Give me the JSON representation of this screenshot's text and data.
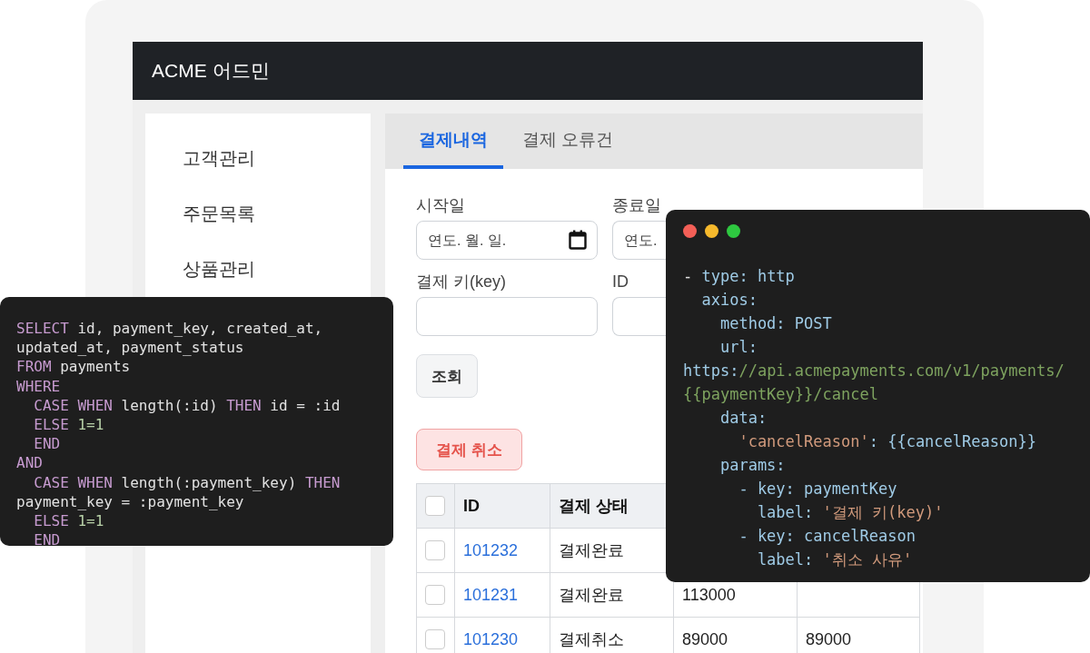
{
  "app": {
    "title": "ACME 어드민"
  },
  "sidebar": {
    "items": [
      {
        "label": "고객관리",
        "selected": false
      },
      {
        "label": "주문목록",
        "selected": false
      },
      {
        "label": "상품관리",
        "selected": false
      }
    ]
  },
  "tabs": [
    {
      "label": "결제내역",
      "selected": true
    },
    {
      "label": "결제 오류건",
      "selected": false
    }
  ],
  "filters": [
    {
      "label": "시작일",
      "placeholder": "연도. 월. 일.",
      "kind": "date"
    },
    {
      "label": "종료일",
      "placeholder": "연도.",
      "kind": "date"
    },
    {
      "label": "결제 키(key)",
      "kind": "text"
    },
    {
      "label": "ID",
      "kind": "text"
    }
  ],
  "search_button": "조회",
  "cancel_button": "결제 취소",
  "table": {
    "header_checked": false,
    "columns": [
      "ID",
      "결제 상태"
    ],
    "rows": [
      {
        "checked": false,
        "id": "101232",
        "status": "결제완료"
      },
      {
        "checked": false,
        "id": "101231",
        "status": "결제완료",
        "column_4": "113000"
      },
      {
        "checked": false,
        "id": "101230",
        "status": "결제취소",
        "column_4": "89000",
        "column_5": "89000"
      }
    ]
  },
  "sql_snippet": {
    "lines": [
      [
        {
          "text": "SELECT",
          "kind": "keyword"
        },
        {
          "text": " id, payment_key, created_at,",
          "kind": "plain"
        }
      ],
      [
        {
          "text": "updated_at, payment_status",
          "kind": "plain"
        }
      ],
      [
        {
          "text": "FROM",
          "kind": "keyword"
        },
        {
          "text": " payments",
          "kind": "plain"
        }
      ],
      [
        {
          "text": "WHERE",
          "kind": "keyword"
        }
      ],
      [
        {
          "text": "  CASE WHEN",
          "kind": "keyword"
        },
        {
          "text": " length(:id) ",
          "kind": "plain"
        },
        {
          "text": "THEN",
          "kind": "keyword"
        },
        {
          "text": " id = :id",
          "kind": "plain"
        }
      ],
      [
        {
          "text": "  ELSE",
          "kind": "keyword"
        },
        {
          "text": " 1=1",
          "kind": "number"
        }
      ],
      [
        {
          "text": "  END",
          "kind": "keyword"
        }
      ],
      [
        {
          "text": "AND",
          "kind": "keyword"
        }
      ],
      [
        {
          "text": "  CASE WHEN",
          "kind": "keyword"
        },
        {
          "text": " length(:payment_key) ",
          "kind": "plain"
        },
        {
          "text": "THEN",
          "kind": "keyword"
        }
      ],
      [
        {
          "text": "payment_key = :payment_key",
          "kind": "plain"
        }
      ],
      [
        {
          "text": "  ELSE",
          "kind": "keyword"
        },
        {
          "text": " 1=1",
          "kind": "number"
        }
      ],
      [
        {
          "text": "  END",
          "kind": "keyword"
        }
      ]
    ]
  },
  "yaml_snippet": {
    "lines": [
      [
        {
          "text": "- ",
          "kind": "plain"
        },
        {
          "text": "type: http",
          "kind": "key"
        }
      ],
      [
        {
          "text": "  axios:",
          "kind": "key"
        }
      ],
      [
        {
          "text": "    method: POST",
          "kind": "key"
        }
      ],
      [
        {
          "text": "    url:",
          "kind": "key"
        }
      ],
      [
        {
          "text": "https:",
          "kind": "key"
        },
        {
          "text": "//api.acmepayments.com/v1/payments/",
          "kind": "url"
        }
      ],
      [
        {
          "text": "{{paymentKey}}/cancel",
          "kind": "url"
        }
      ],
      [
        {
          "text": "    data:",
          "kind": "key"
        }
      ],
      [
        {
          "text": "      'cancelReason'",
          "kind": "string"
        },
        {
          "text": ": {{cancelReason}}",
          "kind": "key"
        }
      ],
      [
        {
          "text": "    params:",
          "kind": "key"
        }
      ],
      [
        {
          "text": "      - key: paymentKey",
          "kind": "key"
        }
      ],
      [
        {
          "text": "        label: ",
          "kind": "key"
        },
        {
          "text": "'결제 키(key)'",
          "kind": "string"
        }
      ],
      [
        {
          "text": "      - key: cancelReason",
          "kind": "key"
        }
      ],
      [
        {
          "text": "        label: ",
          "kind": "key"
        },
        {
          "text": "'취소 사유'",
          "kind": "string"
        }
      ]
    ]
  }
}
